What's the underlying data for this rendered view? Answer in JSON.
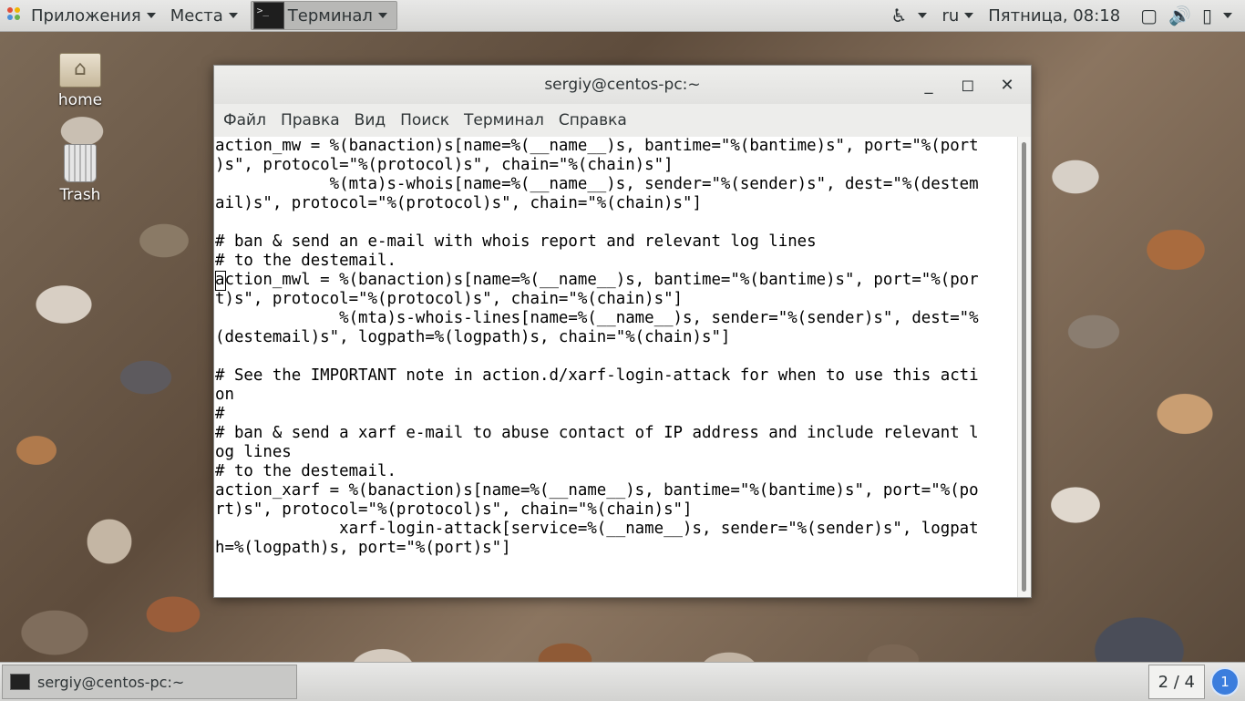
{
  "top_panel": {
    "applications": "Приложения",
    "places": "Места",
    "terminal": "Терминал",
    "language": "ru",
    "clock": "Пятница, 08:18"
  },
  "desktop": {
    "home_label": "home",
    "trash_label": "Trash"
  },
  "window": {
    "title": "sergiy@centos-pc:~",
    "menu": [
      "Файл",
      "Правка",
      "Вид",
      "Поиск",
      "Терминал",
      "Справка"
    ],
    "lines": [
      "action_mw = %(banaction)s[name=%(__name__)s, bantime=\"%(bantime)s\", port=\"%(port",
      ")s\", protocol=\"%(protocol)s\", chain=\"%(chain)s\"]",
      "            %(mta)s-whois[name=%(__name__)s, sender=\"%(sender)s\", dest=\"%(destem",
      "ail)s\", protocol=\"%(protocol)s\", chain=\"%(chain)s\"]",
      "",
      "# ban & send an e-mail with whois report and relevant log lines",
      "# to the destemail.",
      "action_mwl = %(banaction)s[name=%(__name__)s, bantime=\"%(bantime)s\", port=\"%(por",
      "t)s\", protocol=\"%(protocol)s\", chain=\"%(chain)s\"]",
      "             %(mta)s-whois-lines[name=%(__name__)s, sender=\"%(sender)s\", dest=\"%",
      "(destemail)s\", logpath=%(logpath)s, chain=\"%(chain)s\"]",
      "",
      "# See the IMPORTANT note in action.d/xarf-login-attack for when to use this acti",
      "on",
      "#",
      "# ban & send a xarf e-mail to abuse contact of IP address and include relevant l",
      "og lines",
      "# to the destemail.",
      "action_xarf = %(banaction)s[name=%(__name__)s, bantime=\"%(bantime)s\", port=\"%(po",
      "rt)s\", protocol=\"%(protocol)s\", chain=\"%(chain)s\"]",
      "             xarf-login-attack[service=%(__name__)s, sender=\"%(sender)s\", logpat",
      "h=%(logpath)s, port=\"%(port)s\"]"
    ]
  },
  "taskbar": {
    "task_title": "sergiy@centos-pc:~",
    "workspace": "2 / 4",
    "notifications": "1"
  },
  "icons": {
    "accessibility": "accessibility-icon",
    "screen": "display-icon",
    "volume": "volume-icon",
    "battery": "battery-icon"
  }
}
